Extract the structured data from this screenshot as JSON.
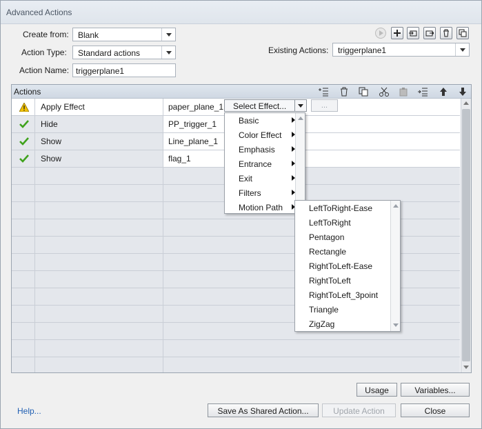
{
  "window": {
    "title": "Advanced Actions"
  },
  "form": {
    "create_from_label": "Create from:",
    "create_from_value": "Blank",
    "action_type_label": "Action Type:",
    "action_type_value": "Standard actions",
    "action_name_label": "Action Name:",
    "action_name_value": "triggerplane1",
    "existing_actions_label": "Existing Actions:",
    "existing_actions_value": "triggerplane1"
  },
  "actions": {
    "header_label": "Actions",
    "rows": [
      {
        "status": "warning",
        "action": "Apply Effect",
        "target": "paper_plane_1"
      },
      {
        "status": "ok",
        "action": "Hide",
        "target": "PP_trigger_1"
      },
      {
        "status": "ok",
        "action": "Show",
        "target": "Line_plane_1"
      },
      {
        "status": "ok",
        "action": "Show",
        "target": "flag_1"
      }
    ],
    "select_effect_label": "Select Effect...",
    "ellipsis_label": "..."
  },
  "effect_menu": {
    "items": [
      "Basic",
      "Color Effect",
      "Emphasis",
      "Entrance",
      "Exit",
      "Filters",
      "Motion Path"
    ]
  },
  "motion_path_menu": {
    "items": [
      "LeftToRight-Ease",
      "LeftToRight",
      "Pentagon",
      "Rectangle",
      "RightToLeft-Ease",
      "RightToLeft",
      "RightToLeft_3point",
      "Triangle",
      "ZigZag"
    ]
  },
  "buttons": {
    "usage": "Usage",
    "variables": "Variables...",
    "save_shared": "Save As Shared Action...",
    "update": "Update Action",
    "close": "Close",
    "help": "Help..."
  },
  "colors": {
    "check_green": "#3fa21c",
    "warning_yellow": "#f2c200",
    "link_blue": "#2160b3"
  }
}
